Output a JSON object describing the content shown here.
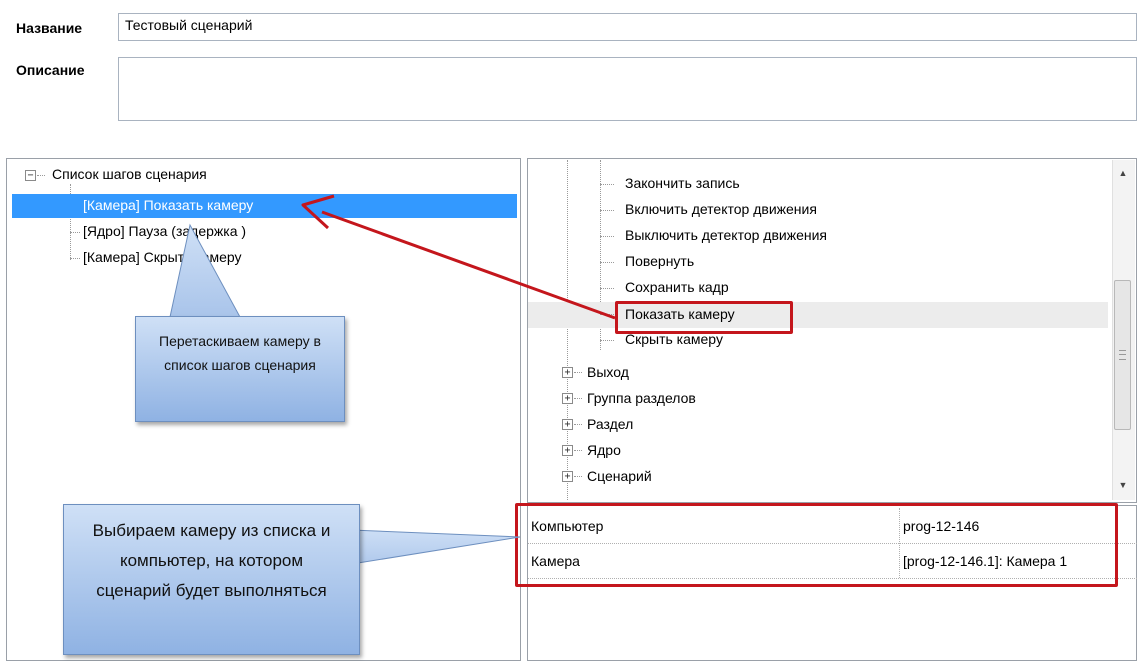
{
  "form": {
    "name_label": "Название",
    "name_value": "Тестовый сценарий",
    "description_label": "Описание",
    "description_value": ""
  },
  "steps_tree": {
    "root_label": "Список шагов сценария",
    "items": [
      {
        "label": "[Камера] Показать камеру",
        "selected": true
      },
      {
        "label": "[Ядро] Пауза (задержка )",
        "selected": false
      },
      {
        "label": "[Камера] Скрыть камеру",
        "selected": false
      }
    ]
  },
  "actions_tree": {
    "camera_actions": [
      "Закончить запись",
      "Включить детектор движения",
      "Выключить детектор движения",
      "Повернуть",
      "Сохранить кадр",
      "Показать камеру",
      "Скрыть камеру"
    ],
    "groups": [
      "Выход",
      "Группа разделов",
      "Раздел",
      "Ядро",
      "Сценарий"
    ]
  },
  "properties": {
    "rows": [
      {
        "name": "Компьютер",
        "value": "prog-12-146"
      },
      {
        "name": "Камера",
        "value": "[prog-12-146.1]: Камера 1"
      }
    ]
  },
  "callouts": {
    "drag": "Перетаскиваем камеру в список шагов сценария",
    "select": "Выбираем камеру из списка и компьютер, на котором сценарий будет выполняться"
  },
  "colors": {
    "selection": "#3399ff",
    "annotation_red": "#c4161c",
    "callout_blue": "#8fb2e3"
  }
}
